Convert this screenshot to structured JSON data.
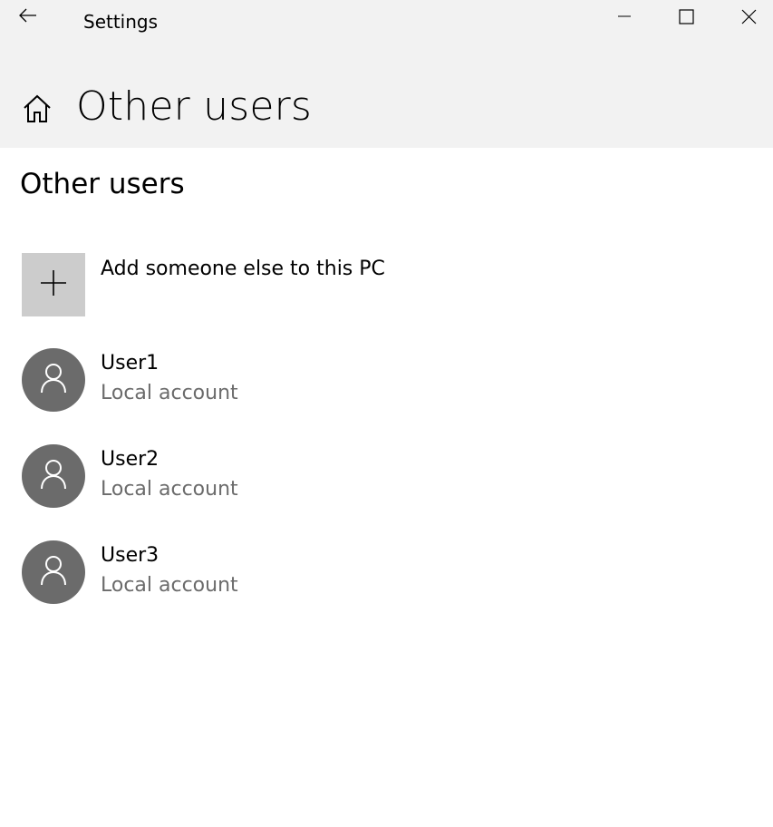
{
  "titlebar": {
    "app_title": "Settings",
    "back_icon": "back-arrow-icon",
    "minimize_icon": "minimize-icon",
    "maximize_icon": "maximize-icon",
    "close_icon": "close-icon"
  },
  "header": {
    "home_icon": "home-icon",
    "page_title": "Other users",
    "background": "#f2f2f2"
  },
  "main": {
    "section_title": "Other users",
    "add_user": {
      "label": "Add someone else to this PC",
      "icon": "plus-icon",
      "tile_color": "#cccccc"
    },
    "users": [
      {
        "name": "User1",
        "account_type": "Local account",
        "icon": "person-icon"
      },
      {
        "name": "User2",
        "account_type": "Local account",
        "icon": "person-icon"
      },
      {
        "name": "User3",
        "account_type": "Local account",
        "icon": "person-icon"
      }
    ],
    "avatar_color": "#6b6b6b",
    "secondary_text_color": "#6b6b6b"
  }
}
